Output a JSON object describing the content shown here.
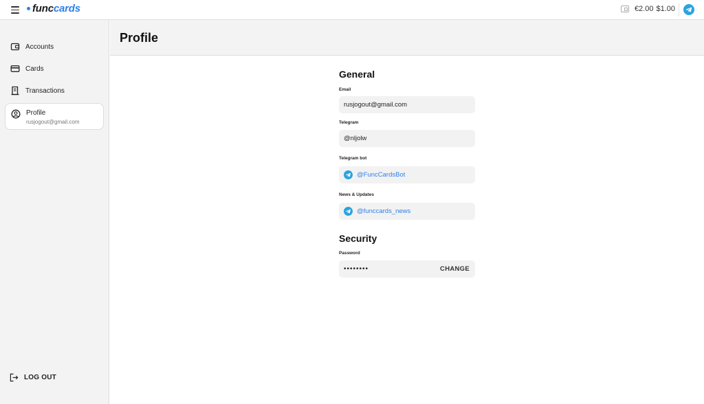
{
  "topbar": {
    "logo_func": "func",
    "logo_cards": "cards",
    "balance_eur": "€2.00",
    "balance_usd": "$1.00"
  },
  "sidebar": {
    "items": [
      {
        "label": "Accounts",
        "icon": "wallet-icon"
      },
      {
        "label": "Cards",
        "icon": "credit-card-icon"
      },
      {
        "label": "Transactions",
        "icon": "receipt-icon"
      },
      {
        "label": "Profile",
        "sublabel": "rusjogout@gmail.com",
        "icon": "user-circle-icon",
        "active": true
      }
    ],
    "logout_label": "LOG OUT"
  },
  "header": {
    "title": "Profile"
  },
  "general": {
    "title": "General",
    "email_label": "Email",
    "email_value": "rusjogout@gmail.com",
    "telegram_label": "Telegram",
    "telegram_value": "@nljolw",
    "bot_label": "Telegram bot",
    "bot_value": "@FuncCardsBot",
    "news_label": "News & Updates",
    "news_value": "@funccards_news"
  },
  "security": {
    "title": "Security",
    "password_label": "Password",
    "password_value": "••••••••",
    "change_label": "CHANGE"
  },
  "colors": {
    "accent": "#2f80ed",
    "telegram": "#2aa3df",
    "sidebar_bg": "#f3f3f3",
    "field_bg": "#f2f2f2"
  }
}
